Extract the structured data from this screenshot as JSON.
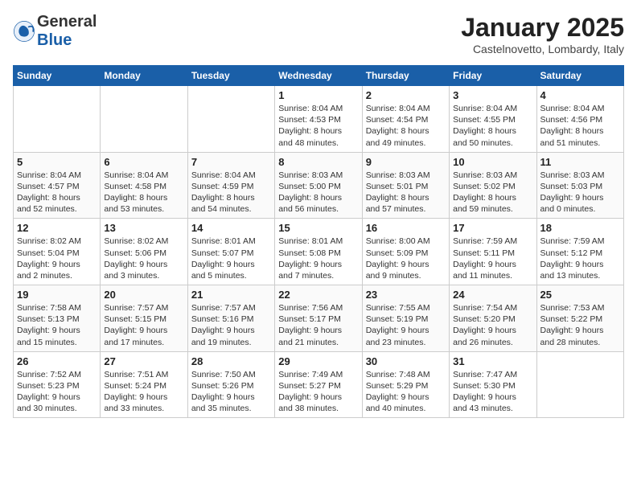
{
  "logo": {
    "general": "General",
    "blue": "Blue"
  },
  "header": {
    "title": "January 2025",
    "subtitle": "Castelnovetto, Lombardy, Italy"
  },
  "weekdays": [
    "Sunday",
    "Monday",
    "Tuesday",
    "Wednesday",
    "Thursday",
    "Friday",
    "Saturday"
  ],
  "weeks": [
    [
      {
        "day": "",
        "info": ""
      },
      {
        "day": "",
        "info": ""
      },
      {
        "day": "",
        "info": ""
      },
      {
        "day": "1",
        "info": "Sunrise: 8:04 AM\nSunset: 4:53 PM\nDaylight: 8 hours\nand 48 minutes."
      },
      {
        "day": "2",
        "info": "Sunrise: 8:04 AM\nSunset: 4:54 PM\nDaylight: 8 hours\nand 49 minutes."
      },
      {
        "day": "3",
        "info": "Sunrise: 8:04 AM\nSunset: 4:55 PM\nDaylight: 8 hours\nand 50 minutes."
      },
      {
        "day": "4",
        "info": "Sunrise: 8:04 AM\nSunset: 4:56 PM\nDaylight: 8 hours\nand 51 minutes."
      }
    ],
    [
      {
        "day": "5",
        "info": "Sunrise: 8:04 AM\nSunset: 4:57 PM\nDaylight: 8 hours\nand 52 minutes."
      },
      {
        "day": "6",
        "info": "Sunrise: 8:04 AM\nSunset: 4:58 PM\nDaylight: 8 hours\nand 53 minutes."
      },
      {
        "day": "7",
        "info": "Sunrise: 8:04 AM\nSunset: 4:59 PM\nDaylight: 8 hours\nand 54 minutes."
      },
      {
        "day": "8",
        "info": "Sunrise: 8:03 AM\nSunset: 5:00 PM\nDaylight: 8 hours\nand 56 minutes."
      },
      {
        "day": "9",
        "info": "Sunrise: 8:03 AM\nSunset: 5:01 PM\nDaylight: 8 hours\nand 57 minutes."
      },
      {
        "day": "10",
        "info": "Sunrise: 8:03 AM\nSunset: 5:02 PM\nDaylight: 8 hours\nand 59 minutes."
      },
      {
        "day": "11",
        "info": "Sunrise: 8:03 AM\nSunset: 5:03 PM\nDaylight: 9 hours\nand 0 minutes."
      }
    ],
    [
      {
        "day": "12",
        "info": "Sunrise: 8:02 AM\nSunset: 5:04 PM\nDaylight: 9 hours\nand 2 minutes."
      },
      {
        "day": "13",
        "info": "Sunrise: 8:02 AM\nSunset: 5:06 PM\nDaylight: 9 hours\nand 3 minutes."
      },
      {
        "day": "14",
        "info": "Sunrise: 8:01 AM\nSunset: 5:07 PM\nDaylight: 9 hours\nand 5 minutes."
      },
      {
        "day": "15",
        "info": "Sunrise: 8:01 AM\nSunset: 5:08 PM\nDaylight: 9 hours\nand 7 minutes."
      },
      {
        "day": "16",
        "info": "Sunrise: 8:00 AM\nSunset: 5:09 PM\nDaylight: 9 hours\nand 9 minutes."
      },
      {
        "day": "17",
        "info": "Sunrise: 7:59 AM\nSunset: 5:11 PM\nDaylight: 9 hours\nand 11 minutes."
      },
      {
        "day": "18",
        "info": "Sunrise: 7:59 AM\nSunset: 5:12 PM\nDaylight: 9 hours\nand 13 minutes."
      }
    ],
    [
      {
        "day": "19",
        "info": "Sunrise: 7:58 AM\nSunset: 5:13 PM\nDaylight: 9 hours\nand 15 minutes."
      },
      {
        "day": "20",
        "info": "Sunrise: 7:57 AM\nSunset: 5:15 PM\nDaylight: 9 hours\nand 17 minutes."
      },
      {
        "day": "21",
        "info": "Sunrise: 7:57 AM\nSunset: 5:16 PM\nDaylight: 9 hours\nand 19 minutes."
      },
      {
        "day": "22",
        "info": "Sunrise: 7:56 AM\nSunset: 5:17 PM\nDaylight: 9 hours\nand 21 minutes."
      },
      {
        "day": "23",
        "info": "Sunrise: 7:55 AM\nSunset: 5:19 PM\nDaylight: 9 hours\nand 23 minutes."
      },
      {
        "day": "24",
        "info": "Sunrise: 7:54 AM\nSunset: 5:20 PM\nDaylight: 9 hours\nand 26 minutes."
      },
      {
        "day": "25",
        "info": "Sunrise: 7:53 AM\nSunset: 5:22 PM\nDaylight: 9 hours\nand 28 minutes."
      }
    ],
    [
      {
        "day": "26",
        "info": "Sunrise: 7:52 AM\nSunset: 5:23 PM\nDaylight: 9 hours\nand 30 minutes."
      },
      {
        "day": "27",
        "info": "Sunrise: 7:51 AM\nSunset: 5:24 PM\nDaylight: 9 hours\nand 33 minutes."
      },
      {
        "day": "28",
        "info": "Sunrise: 7:50 AM\nSunset: 5:26 PM\nDaylight: 9 hours\nand 35 minutes."
      },
      {
        "day": "29",
        "info": "Sunrise: 7:49 AM\nSunset: 5:27 PM\nDaylight: 9 hours\nand 38 minutes."
      },
      {
        "day": "30",
        "info": "Sunrise: 7:48 AM\nSunset: 5:29 PM\nDaylight: 9 hours\nand 40 minutes."
      },
      {
        "day": "31",
        "info": "Sunrise: 7:47 AM\nSunset: 5:30 PM\nDaylight: 9 hours\nand 43 minutes."
      },
      {
        "day": "",
        "info": ""
      }
    ]
  ]
}
